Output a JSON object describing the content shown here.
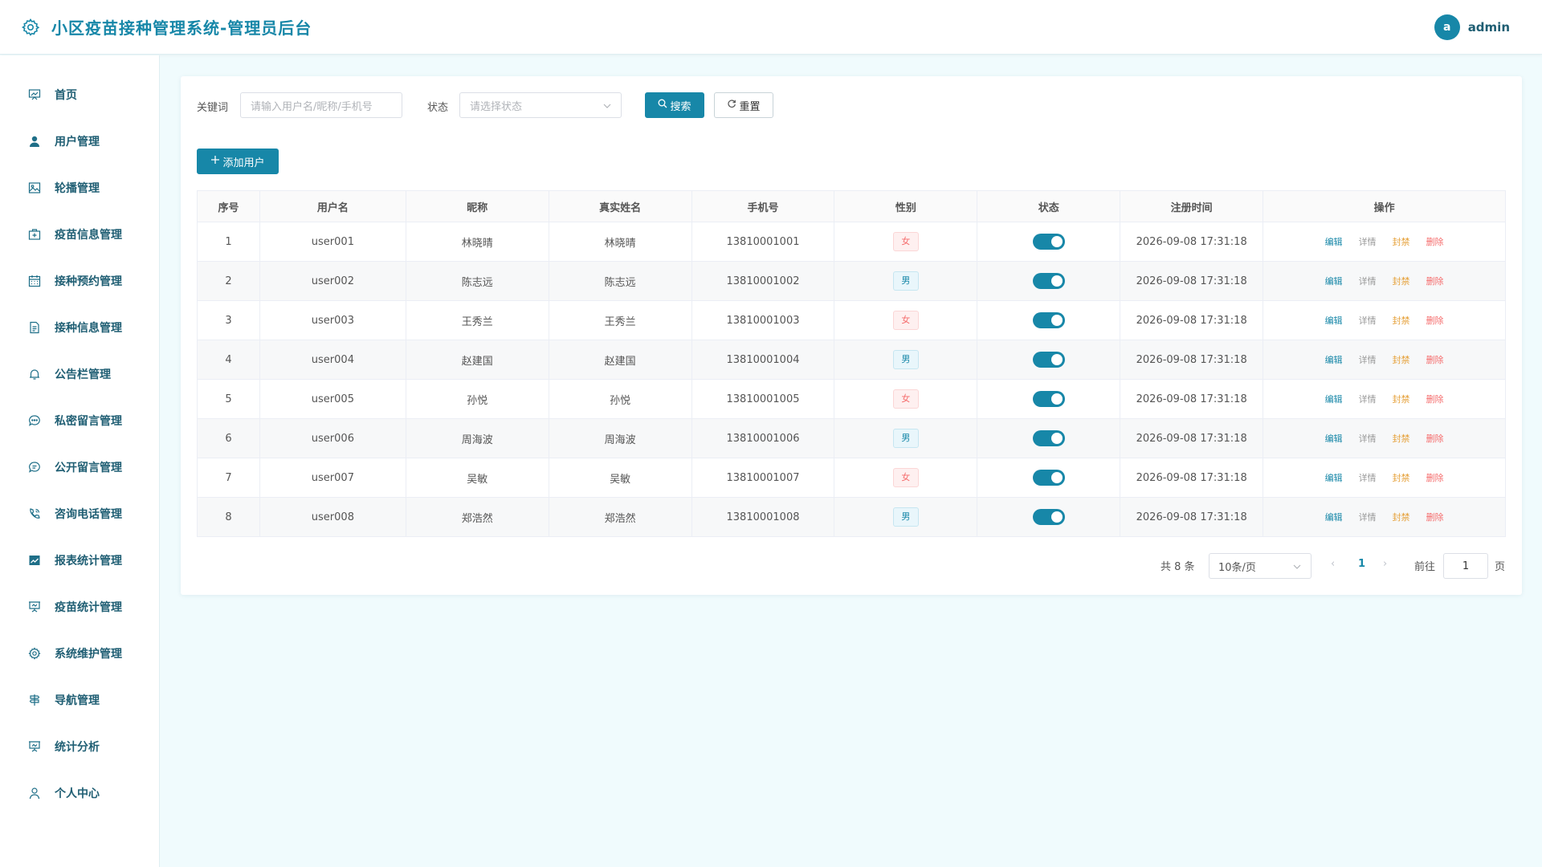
{
  "header": {
    "title": "小区疫苗接种管理系统-管理员后台",
    "avatar_letter": "a",
    "username": "admin"
  },
  "sidebar": {
    "items": [
      {
        "label": "首页",
        "icon": "chart-board-icon"
      },
      {
        "label": "用户管理",
        "icon": "user-icon"
      },
      {
        "label": "轮播管理",
        "icon": "image-icon"
      },
      {
        "label": "疫苗信息管理",
        "icon": "medical-box-icon"
      },
      {
        "label": "接种预约管理",
        "icon": "calendar-icon"
      },
      {
        "label": "接种信息管理",
        "icon": "document-icon"
      },
      {
        "label": "公告栏管理",
        "icon": "bell-icon"
      },
      {
        "label": "私密留言管理",
        "icon": "chat-dots-icon"
      },
      {
        "label": "公开留言管理",
        "icon": "chat-lines-icon"
      },
      {
        "label": "咨询电话管理",
        "icon": "phone-icon"
      },
      {
        "label": "报表统计管理",
        "icon": "trend-chart-icon"
      },
      {
        "label": "疫苗统计管理",
        "icon": "presentation-icon"
      },
      {
        "label": "系统维护管理",
        "icon": "gear-icon"
      },
      {
        "label": "导航管理",
        "icon": "nav-icon"
      },
      {
        "label": "统计分析",
        "icon": "board-icon"
      },
      {
        "label": "个人中心",
        "icon": "person-icon"
      }
    ]
  },
  "search": {
    "keyword_label": "关键词",
    "keyword_placeholder": "请输入用户名/昵称/手机号",
    "status_label": "状态",
    "status_placeholder": "请选择状态",
    "search_button": "搜索",
    "reset_button": "重置"
  },
  "add_button": "添加用户",
  "table": {
    "headers": [
      "序号",
      "用户名",
      "昵称",
      "真实姓名",
      "手机号",
      "性别",
      "状态",
      "注册时间",
      "操作"
    ],
    "actions": {
      "edit": "编辑",
      "detail": "详情",
      "ban": "封禁",
      "delete": "删除"
    },
    "rows": [
      {
        "no": "1",
        "username": "user001",
        "nickname": "林晓晴",
        "realname": "林晓晴",
        "phone": "13810001001",
        "gender": "女",
        "enabled": true,
        "registered": "2026-09-08 17:31:18"
      },
      {
        "no": "2",
        "username": "user002",
        "nickname": "陈志远",
        "realname": "陈志远",
        "phone": "13810001002",
        "gender": "男",
        "enabled": true,
        "registered": "2026-09-08 17:31:18"
      },
      {
        "no": "3",
        "username": "user003",
        "nickname": "王秀兰",
        "realname": "王秀兰",
        "phone": "13810001003",
        "gender": "女",
        "enabled": true,
        "registered": "2026-09-08 17:31:18"
      },
      {
        "no": "4",
        "username": "user004",
        "nickname": "赵建国",
        "realname": "赵建国",
        "phone": "13810001004",
        "gender": "男",
        "enabled": true,
        "registered": "2026-09-08 17:31:18"
      },
      {
        "no": "5",
        "username": "user005",
        "nickname": "孙悦",
        "realname": "孙悦",
        "phone": "13810001005",
        "gender": "女",
        "enabled": true,
        "registered": "2026-09-08 17:31:18"
      },
      {
        "no": "6",
        "username": "user006",
        "nickname": "周海波",
        "realname": "周海波",
        "phone": "13810001006",
        "gender": "男",
        "enabled": true,
        "registered": "2026-09-08 17:31:18"
      },
      {
        "no": "7",
        "username": "user007",
        "nickname": "吴敏",
        "realname": "吴敏",
        "phone": "13810001007",
        "gender": "女",
        "enabled": true,
        "registered": "2026-09-08 17:31:18"
      },
      {
        "no": "8",
        "username": "user008",
        "nickname": "郑浩然",
        "realname": "郑浩然",
        "phone": "13810001008",
        "gender": "男",
        "enabled": true,
        "registered": "2026-09-08 17:31:18"
      }
    ]
  },
  "pagination": {
    "total": "共 8 条",
    "page_size": "10条/页",
    "current_page": "1",
    "goto_label": "前往",
    "goto_value": "1",
    "page_suffix": "页"
  },
  "colors": {
    "primary": "#1787a8",
    "female_tag": "#f56c6c",
    "ban": "#e6a23c",
    "danger": "#f56c6c"
  }
}
